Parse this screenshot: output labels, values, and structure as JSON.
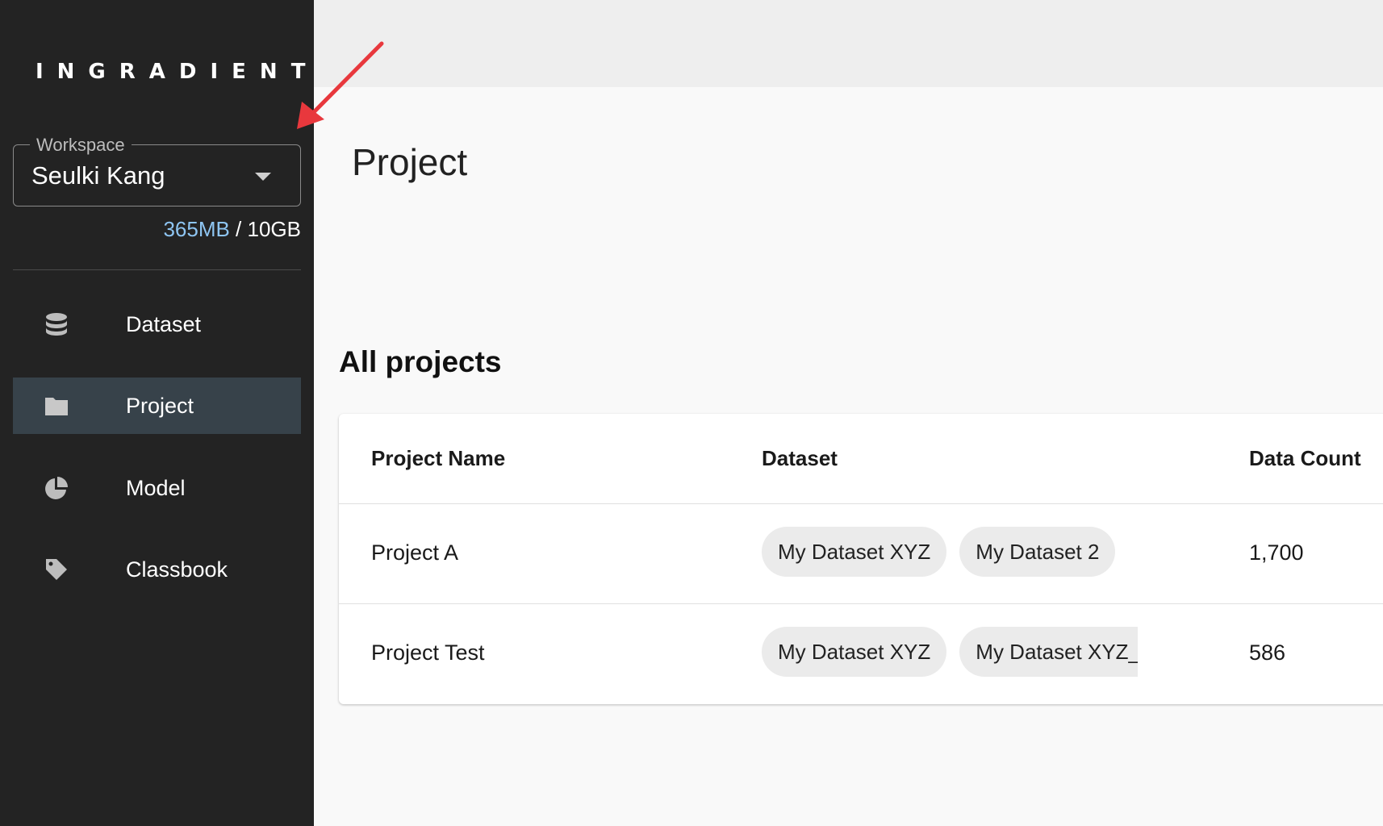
{
  "sidebar": {
    "logo": "INGRADIENT",
    "workspace": {
      "label": "Workspace",
      "value": "Seulki Kang"
    },
    "storage": {
      "used": "365MB",
      "separator": " / ",
      "total": "10GB"
    },
    "items": [
      {
        "label": "Dataset",
        "icon": "database-icon",
        "active": false
      },
      {
        "label": "Project",
        "icon": "folder-icon",
        "active": true
      },
      {
        "label": "Model",
        "icon": "pie-chart-icon",
        "active": false
      },
      {
        "label": "Classbook",
        "icon": "tag-icon",
        "active": false
      }
    ]
  },
  "main": {
    "page_title": "Project",
    "section_title": "All projects",
    "table": {
      "columns": [
        "Project Name",
        "Dataset",
        "Data Count"
      ],
      "rows": [
        {
          "name": "Project A",
          "datasets": [
            "My Dataset XYZ",
            "My Dataset 2"
          ],
          "count": "1,700"
        },
        {
          "name": "Project Test",
          "datasets": [
            "My Dataset XYZ",
            "My Dataset XYZ_A"
          ],
          "count": "586"
        }
      ]
    }
  },
  "colors": {
    "sidebar_bg": "#232323",
    "active_item_bg": "#37424a",
    "storage_used": "#8ec5f2",
    "annotation_arrow": "#e8383d"
  }
}
